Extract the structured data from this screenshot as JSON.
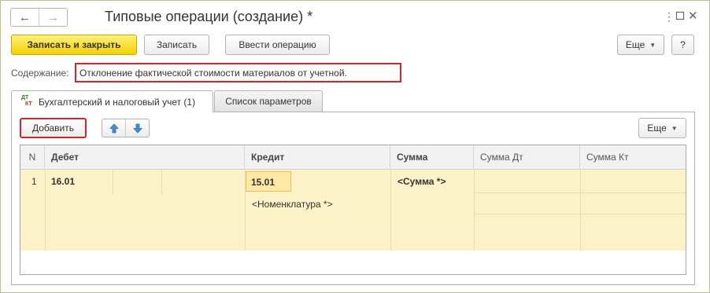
{
  "titlebar": {
    "back_icon": "arrow-left-icon",
    "forward_icon": "arrow-right-icon",
    "title": "Типовые операции (создание) *",
    "menu_icon": "more-vertical-icon",
    "maximize_icon": "maximize-icon",
    "close_icon": "close-icon"
  },
  "toolbar": {
    "save_close_label": "Записать и закрыть",
    "save_label": "Записать",
    "enter_operation_label": "Ввести операцию",
    "more_label": "Еще",
    "help_label": "?"
  },
  "content": {
    "label": "Содержание:",
    "value": "Отклонение фактической стоимости материалов от учетной."
  },
  "tabs": [
    {
      "label": "Бухгалтерский и налоговый учет (1)",
      "icon_dt": "ДТ",
      "icon_kt": "КТ",
      "active": true
    },
    {
      "label": "Список параметров",
      "active": false
    }
  ],
  "panel_toolbar": {
    "add_label": "Добавить",
    "move_up_icon": "arrow-up-icon",
    "move_down_icon": "arrow-down-icon",
    "more_label": "Еще"
  },
  "table": {
    "columns": [
      "N",
      "Дебет",
      "Кредит",
      "Сумма",
      "Сумма Дт",
      "Сумма Кт"
    ],
    "rows": [
      {
        "n": "1",
        "debit": "16.01",
        "credit": "15.01",
        "credit_sub": "<Номенклатура *>",
        "sum": "<Сумма *>",
        "sum_dt": "",
        "sum_kt": ""
      }
    ]
  },
  "colors": {
    "primary_button": "#f5d000",
    "highlight_border": "#d8232a",
    "row_background": "#fcf2c8"
  }
}
